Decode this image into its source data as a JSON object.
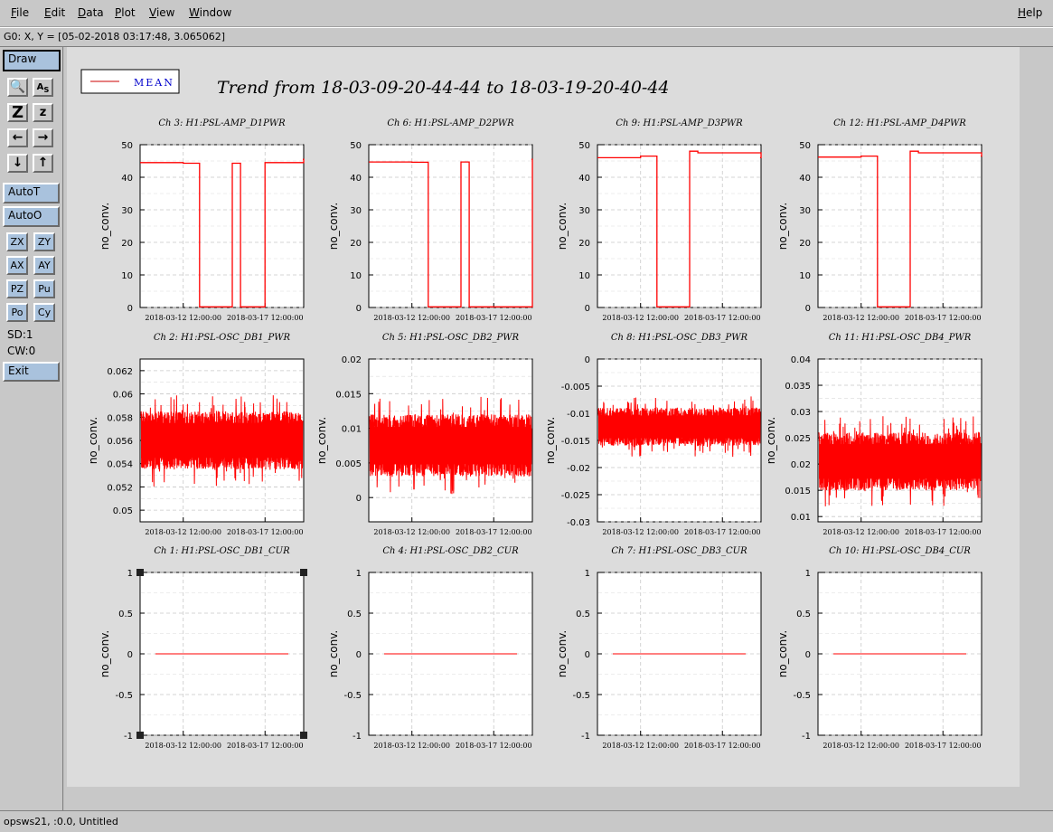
{
  "menubar": {
    "items": [
      {
        "label": "File",
        "underline": "F",
        "rest": "ile"
      },
      {
        "label": "Edit",
        "underline": "E",
        "rest": "dit"
      },
      {
        "label": "Data",
        "underline": "D",
        "rest": "ata"
      },
      {
        "label": "Plot",
        "underline": "P",
        "rest": "lot"
      },
      {
        "label": "View",
        "underline": "V",
        "rest": "iew"
      },
      {
        "label": "Window",
        "underline": "W",
        "rest": "indow"
      }
    ],
    "help": {
      "underline": "H",
      "rest": "elp"
    }
  },
  "coord_readout": "G0: X, Y = [05-02-2018 03:17:48, 3.065062]",
  "toolbar": {
    "draw": "Draw",
    "autot": "AutoT",
    "autoo": "AutoO",
    "zx": "ZX",
    "zy": "ZY",
    "ax": "AX",
    "ay": "AY",
    "pz": "PZ",
    "pu": "Pu",
    "po": "Po",
    "cy": "Cy",
    "sd": "SD:1",
    "cw": "CW:0",
    "exit": "Exit"
  },
  "statusbar": "opsws21, :0.0, Untitled",
  "legend": {
    "label": "MEAN",
    "color": "#cc0000"
  },
  "main_title": "Trend from 18-03-09-20-44-44 to 18-03-19-20-40-44",
  "colors": {
    "series": "#ff0000",
    "legend_text": "#0000cc",
    "plot_bg": "#ffffff",
    "canvas_bg": "#dcdcdc"
  },
  "ylabel": "no_conv.",
  "x_ticks": [
    "2018-03-12 12:00:00",
    "2018-03-17 12:00:00"
  ],
  "chart_data": [
    {
      "type": "line",
      "title": "Ch 3: H1:PSL-AMP_D1PWR",
      "ylabel": "no_conv.",
      "ylim": [
        0,
        50
      ],
      "yticks": [
        "50",
        "40",
        "30",
        "20",
        "10",
        "0"
      ],
      "x": [
        "2018-03-09 20:44:44",
        "2018-03-12 12:00:00",
        "2018-03-13 12:00:00",
        "2018-03-14 00:00:00",
        "2018-03-15 12:00:00",
        "2018-03-16 00:00:00",
        "2018-03-17 12:00:00",
        "2018-03-19 20:40:44"
      ],
      "values": [
        44.5,
        44.3,
        0.2,
        0.2,
        44.3,
        0.2,
        44.5,
        45.5
      ],
      "series": [
        {
          "name": "MEAN",
          "values": [
            44.5,
            44.3,
            0.2,
            0.2,
            44.3,
            0.2,
            44.5,
            45.5
          ]
        }
      ]
    },
    {
      "type": "line",
      "title": "Ch 6: H1:PSL-AMP_D2PWR",
      "ylabel": "no_conv.",
      "ylim": [
        0,
        50
      ],
      "yticks": [
        "50",
        "40",
        "30",
        "20",
        "10",
        "0"
      ],
      "x": [
        "2018-03-09 20:44:44",
        "2018-03-12 12:00:00",
        "2018-03-13 12:00:00",
        "2018-03-15 12:00:00",
        "2018-03-16 00:00:00",
        "2018-03-19 20:40:44"
      ],
      "values": [
        44.7,
        44.6,
        0.2,
        44.7,
        0.2,
        45.5
      ],
      "series": [
        {
          "name": "MEAN",
          "values": [
            44.7,
            44.6,
            0.2,
            44.7,
            0.2,
            45.5
          ]
        }
      ]
    },
    {
      "type": "line",
      "title": "Ch 9: H1:PSL-AMP_D3PWR",
      "ylabel": "no_conv.",
      "ylim": [
        0,
        50
      ],
      "yticks": [
        "50",
        "40",
        "30",
        "20",
        "10",
        "0"
      ],
      "x": [
        "2018-03-09 20:44:44",
        "2018-03-12 12:00:00",
        "2018-03-13 12:00:00",
        "2018-03-15 12:00:00",
        "2018-03-16 00:00:00",
        "2018-03-19 20:40:44"
      ],
      "values": [
        46.0,
        46.5,
        0.2,
        48.0,
        47.5,
        46.0
      ],
      "series": [
        {
          "name": "MEAN",
          "values": [
            46.0,
            46.5,
            0.2,
            48.0,
            47.5,
            46.0
          ]
        }
      ]
    },
    {
      "type": "line",
      "title": "Ch 12: H1:PSL-AMP_D4PWR",
      "ylabel": "no_conv.",
      "ylim": [
        0,
        50
      ],
      "yticks": [
        "50",
        "40",
        "30",
        "20",
        "10",
        "0"
      ],
      "x": [
        "2018-03-09 20:44:44",
        "2018-03-12 12:00:00",
        "2018-03-13 12:00:00",
        "2018-03-15 12:00:00",
        "2018-03-16 00:00:00",
        "2018-03-19 20:40:44"
      ],
      "values": [
        46.2,
        46.5,
        0.2,
        48.0,
        47.5,
        46.5
      ],
      "series": [
        {
          "name": "MEAN",
          "values": [
            46.2,
            46.5,
            0.2,
            48.0,
            47.5,
            46.5
          ]
        }
      ]
    },
    {
      "type": "line",
      "title": "Ch 2: H1:PSL-OSC_DB1_PWR",
      "ylabel": "no_conv.",
      "ylim": [
        0.049,
        0.063
      ],
      "yticks": [
        "0.062",
        "0.06",
        "0.058",
        "0.056",
        "0.054",
        "0.052",
        "0.05"
      ],
      "noise": {
        "center": 0.056,
        "spread": 0.0025
      }
    },
    {
      "type": "line",
      "title": "Ch 5: H1:PSL-OSC_DB2_PWR",
      "ylabel": "no_conv.",
      "ylim": [
        -0.0035,
        0.02
      ],
      "yticks": [
        "0.02",
        "0.015",
        "0.01",
        "0.005",
        "0"
      ],
      "noise": {
        "center": 0.0075,
        "spread": 0.0045
      }
    },
    {
      "type": "line",
      "title": "Ch 8: H1:PSL-OSC_DB3_PWR",
      "ylabel": "no_conv.",
      "ylim": [
        -0.03,
        0
      ],
      "yticks": [
        "0",
        "-0.005",
        "-0.01",
        "-0.015",
        "-0.02",
        "-0.025",
        "-0.03"
      ],
      "noise": {
        "center": -0.0125,
        "spread": 0.0035
      }
    },
    {
      "type": "line",
      "title": "Ch 11: H1:PSL-OSC_DB4_PWR",
      "ylabel": "no_conv.",
      "ylim": [
        0.009,
        0.04
      ],
      "yticks": [
        "0.04",
        "0.035",
        "0.03",
        "0.025",
        "0.02",
        "0.015",
        "0.01"
      ],
      "noise": {
        "center": 0.0205,
        "spread": 0.0055
      }
    },
    {
      "type": "line",
      "title": "Ch 1: H1:PSL-OSC_DB1_CUR",
      "ylabel": "no_conv.",
      "ylim": [
        -1,
        1
      ],
      "yticks": [
        "1",
        "0.5",
        "0",
        "-0.5",
        "-1"
      ],
      "values": [
        0,
        0
      ],
      "series": [
        {
          "name": "MEAN",
          "values": [
            0,
            0
          ]
        }
      ]
    },
    {
      "type": "line",
      "title": "Ch 4: H1:PSL-OSC_DB2_CUR",
      "ylabel": "no_conv.",
      "ylim": [
        -1,
        1
      ],
      "yticks": [
        "1",
        "0.5",
        "0",
        "-0.5",
        "-1"
      ],
      "values": [
        0,
        0
      ],
      "series": [
        {
          "name": "MEAN",
          "values": [
            0,
            0
          ]
        }
      ]
    },
    {
      "type": "line",
      "title": "Ch 7: H1:PSL-OSC_DB3_CUR",
      "ylabel": "no_conv.",
      "ylim": [
        -1,
        1
      ],
      "yticks": [
        "1",
        "0.5",
        "0",
        "-0.5",
        "-1"
      ],
      "values": [
        0,
        0
      ],
      "series": [
        {
          "name": "MEAN",
          "values": [
            0,
            0
          ]
        }
      ]
    },
    {
      "type": "line",
      "title": "Ch 10: H1:PSL-OSC_DB4_CUR",
      "ylabel": "no_conv.",
      "ylim": [
        -1,
        1
      ],
      "yticks": [
        "1",
        "0.5",
        "0",
        "-0.5",
        "-1"
      ],
      "values": [
        0,
        0
      ],
      "series": [
        {
          "name": "MEAN",
          "values": [
            0,
            0
          ]
        }
      ]
    }
  ]
}
